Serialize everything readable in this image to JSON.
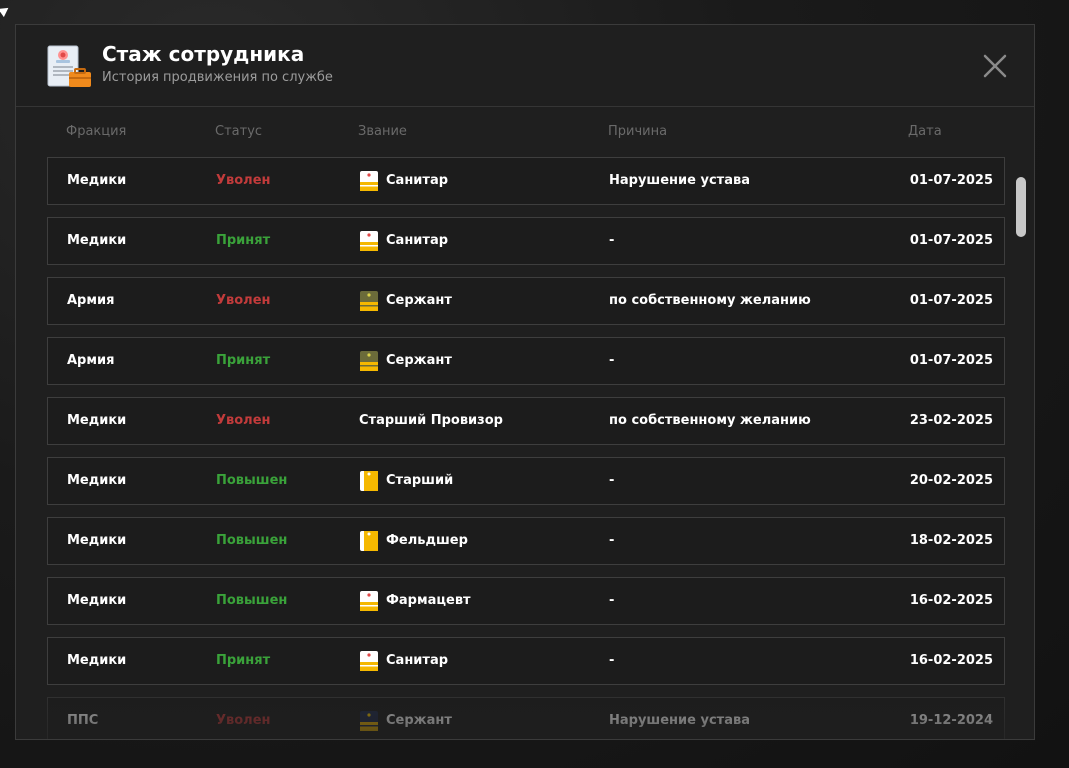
{
  "header": {
    "title": "Стаж сотрудника",
    "subtitle": "История продвижения по службе"
  },
  "columns": {
    "fraction": "Фракция",
    "status": "Статус",
    "rank": "Звание",
    "reason": "Причина",
    "date": "Дата"
  },
  "rows": [
    {
      "fraction": "Медики",
      "status": "Уволен",
      "status_type": "fired",
      "rank": "Санитар",
      "rank_icon": "medic-white",
      "reason": "Нарушение устава",
      "date": "01-07-2025"
    },
    {
      "fraction": "Медики",
      "status": "Принят",
      "status_type": "hired",
      "rank": "Санитар",
      "rank_icon": "medic-white",
      "reason": "-",
      "date": "01-07-2025"
    },
    {
      "fraction": "Армия",
      "status": "Уволен",
      "status_type": "fired",
      "rank": "Сержант",
      "rank_icon": "army-olive",
      "reason": "по собственному желанию",
      "date": "01-07-2025"
    },
    {
      "fraction": "Армия",
      "status": "Принят",
      "status_type": "hired",
      "rank": "Сержант",
      "rank_icon": "army-olive",
      "reason": "-",
      "date": "01-07-2025"
    },
    {
      "fraction": "Медики",
      "status": "Уволен",
      "status_type": "fired",
      "rank": "Старший Провизор",
      "rank_icon": "",
      "reason": "по собственному желанию",
      "date": "23-02-2025"
    },
    {
      "fraction": "Медики",
      "status": "Повышен",
      "status_type": "promoted",
      "rank": "Старший",
      "rank_icon": "medic-yellow",
      "reason": "-",
      "date": "20-02-2025"
    },
    {
      "fraction": "Медики",
      "status": "Повышен",
      "status_type": "promoted",
      "rank": "Фельдшер",
      "rank_icon": "medic-yellow",
      "reason": "-",
      "date": "18-02-2025"
    },
    {
      "fraction": "Медики",
      "status": "Повышен",
      "status_type": "promoted",
      "rank": "Фармацевт",
      "rank_icon": "medic-white",
      "reason": "-",
      "date": "16-02-2025"
    },
    {
      "fraction": "Медики",
      "status": "Принят",
      "status_type": "hired",
      "rank": "Санитар",
      "rank_icon": "medic-white",
      "reason": "-",
      "date": "16-02-2025"
    },
    {
      "fraction": "ППС",
      "status": "Уволен",
      "status_type": "fired",
      "rank": "Сержант",
      "rank_icon": "police-navy",
      "reason": "Нарушение устава",
      "date": "19-12-2024"
    }
  ],
  "icons": {
    "header": "certificate-briefcase-icon",
    "close": "close-icon"
  },
  "colors": {
    "fired": "#c23b3b",
    "hired": "#3aa23a",
    "promoted": "#3aa23a",
    "medic_yellow": "#f5b800",
    "army_olive": "#6b6b3a",
    "police_navy": "#1f2a4a"
  }
}
